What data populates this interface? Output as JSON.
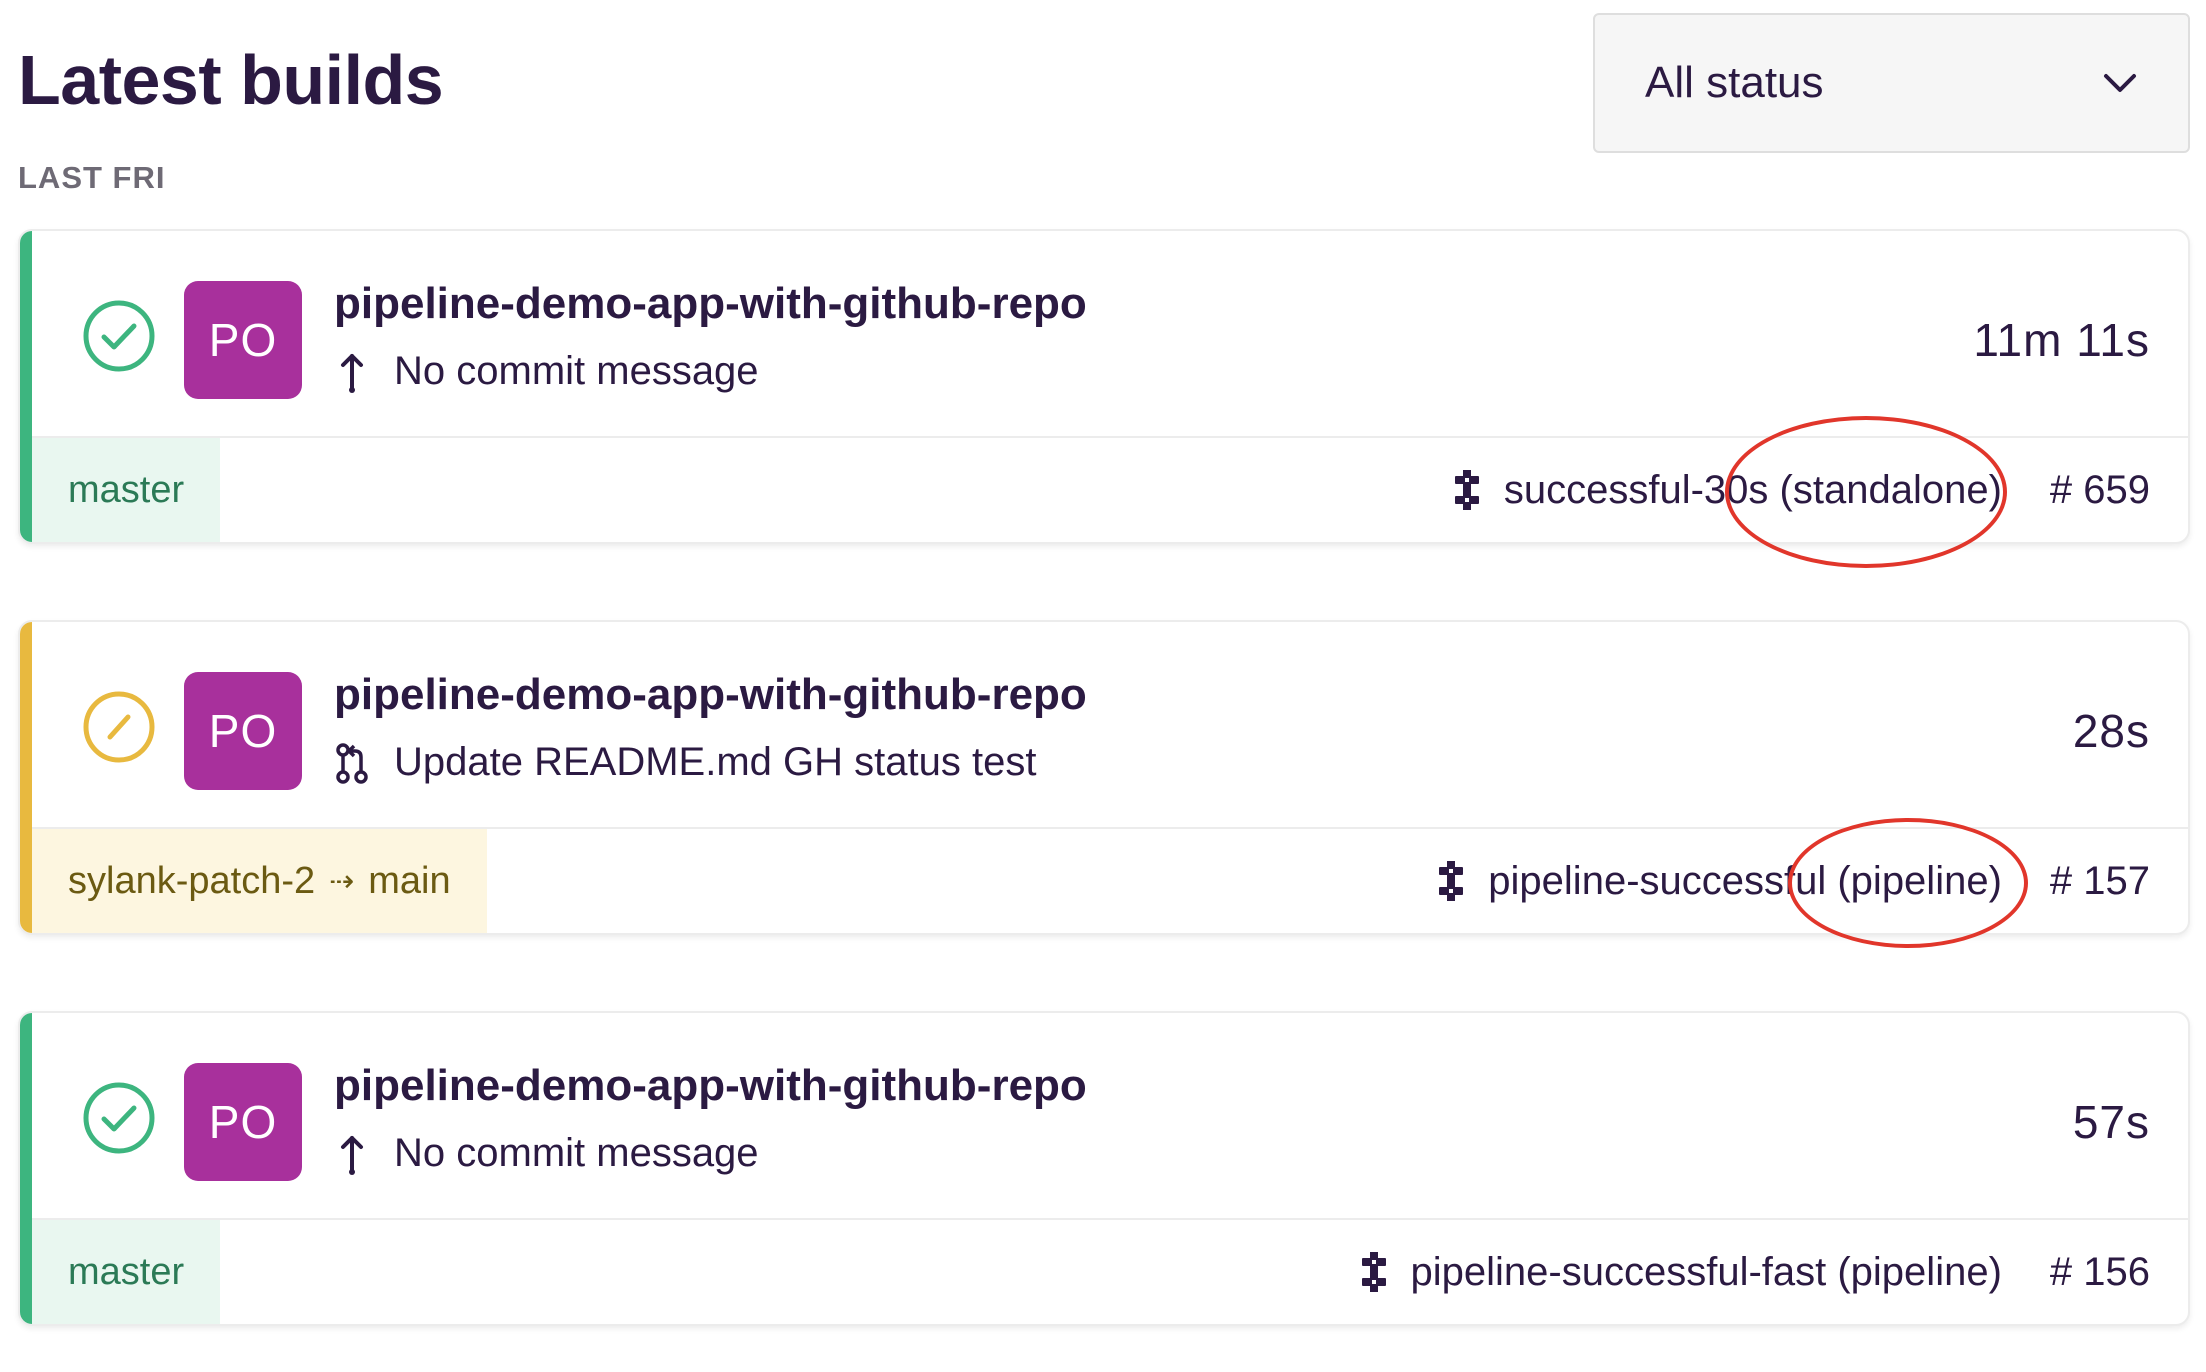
{
  "header": {
    "title": "Latest builds",
    "date_label": "LAST FRI",
    "status_filter": {
      "selected": "All status",
      "icon": "chevron-down-icon"
    }
  },
  "colors": {
    "success": "#3db57f",
    "in_progress": "#e8b93f",
    "avatar": "#a8309c",
    "annotation": "#e1362b"
  },
  "builds": [
    {
      "status": "success",
      "avatar": "PO",
      "project": "pipeline-demo-app-with-github-repo",
      "commit_icon": "push-arrow-icon",
      "commit_message": "No commit message",
      "duration": "11m 11s",
      "branch": "master",
      "branch_target": "",
      "pipeline_icon": "pipeline-icon",
      "pipeline": "successful-30s (standalone)",
      "build_number": "# 659"
    },
    {
      "status": "in_progress",
      "avatar": "PO",
      "project": "pipeline-demo-app-with-github-repo",
      "commit_icon": "pull-request-icon",
      "commit_message": "Update README.md GH status test",
      "duration": "28s",
      "branch": "sylank-patch-2",
      "branch_arrow": "⇢",
      "branch_target": "main",
      "pipeline_icon": "pipeline-icon",
      "pipeline": "pipeline-successful (pipeline)",
      "build_number": "# 157"
    },
    {
      "status": "success",
      "avatar": "PO",
      "project": "pipeline-demo-app-with-github-repo",
      "commit_icon": "push-arrow-icon",
      "commit_message": "No commit message",
      "duration": "57s",
      "branch": "master",
      "branch_target": "",
      "pipeline_icon": "pipeline-icon",
      "pipeline": "pipeline-successful-fast (pipeline)",
      "build_number": "# 156"
    }
  ]
}
